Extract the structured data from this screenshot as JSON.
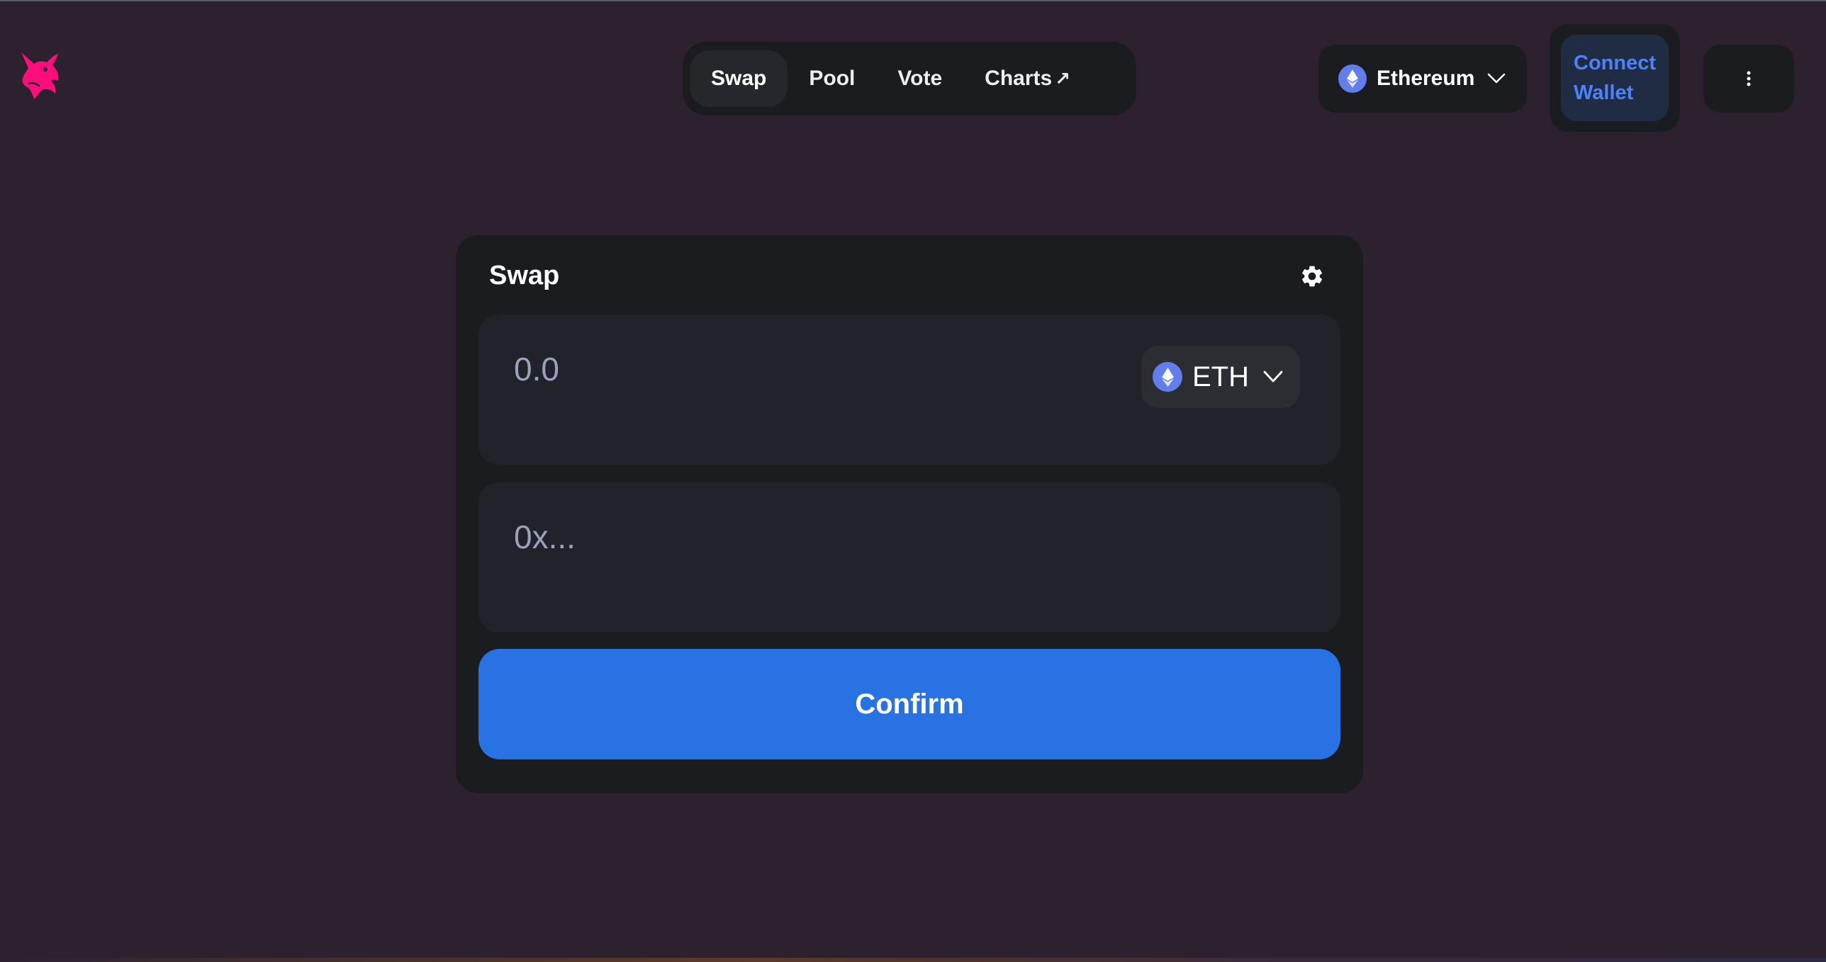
{
  "header": {
    "logo_icon": "uniswap-unicorn-logo-icon",
    "nav": [
      {
        "label": "Swap",
        "active": true
      },
      {
        "label": "Pool",
        "active": false
      },
      {
        "label": "Vote",
        "active": false
      },
      {
        "label": "Charts",
        "active": false,
        "external": "↗"
      }
    ],
    "network": {
      "label": "Ethereum",
      "icon": "ethereum-icon"
    },
    "connect_wallet": "Connect Wallet",
    "more_icon": "more-vertical-icon"
  },
  "swap_card": {
    "title": "Swap",
    "settings_icon": "gear-icon",
    "amount_input": {
      "value": "",
      "placeholder": "0.0"
    },
    "token": {
      "symbol": "ETH",
      "icon": "ethereum-icon"
    },
    "recipient_input": {
      "value": "",
      "placeholder": "0x..."
    },
    "confirm_label": "Confirm"
  },
  "colors": {
    "background": "#2d212f",
    "card": "#1b1c20",
    "panel": "#22232a",
    "accent_blue": "#2872e3",
    "connect_text": "#4c82fb",
    "logo_pink": "#fc0f7a",
    "eth_blue": "#627eea"
  }
}
